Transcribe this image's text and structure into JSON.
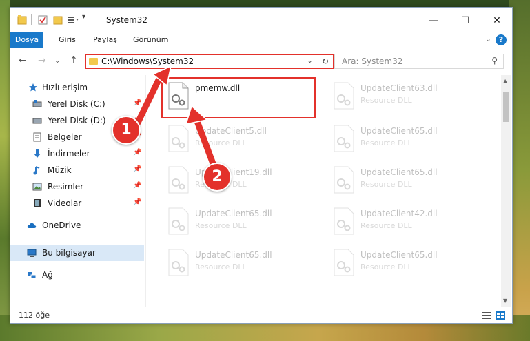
{
  "window": {
    "title": "System32",
    "controls": {
      "minimize": "—",
      "maximize": "☐",
      "close": "✕"
    }
  },
  "ribbon": {
    "tabs": [
      {
        "label": "Dosya",
        "active": true
      },
      {
        "label": "Giriş",
        "active": false
      },
      {
        "label": "Paylaş",
        "active": false
      },
      {
        "label": "Görünüm",
        "active": false
      }
    ],
    "help": "?",
    "collapse": "⌄"
  },
  "nav": {
    "back": "←",
    "forward": "→",
    "recent": "⌄",
    "up": "↑",
    "address": "C:\\Windows\\System32",
    "address_dropdown": "⌄",
    "refresh": "↻",
    "search_placeholder": "Ara: System32",
    "search_icon": "⚲"
  },
  "sidebar": {
    "items": [
      {
        "label": "Hızlı erişim",
        "icon": "star-icon",
        "pinned": false
      },
      {
        "label": "Yerel Disk (C:)",
        "icon": "drive-icon",
        "pinned": true
      },
      {
        "label": "Yerel Disk (D:)",
        "icon": "drive-icon",
        "pinned": true
      },
      {
        "label": "Belgeler",
        "icon": "document-icon",
        "pinned": true
      },
      {
        "label": "İndirmeler",
        "icon": "download-icon",
        "pinned": true
      },
      {
        "label": "Müzik",
        "icon": "music-icon",
        "pinned": true
      },
      {
        "label": "Resimler",
        "icon": "pictures-icon",
        "pinned": true
      },
      {
        "label": "Videolar",
        "icon": "video-icon",
        "pinned": true
      },
      {
        "label": "OneDrive",
        "icon": "cloud-icon",
        "pinned": false
      },
      {
        "label": "Bu bilgisayar",
        "icon": "computer-icon",
        "pinned": false,
        "selected": true
      },
      {
        "label": "Ağ",
        "icon": "network-icon",
        "pinned": false
      }
    ],
    "pin_glyph": "📌"
  },
  "files": [
    {
      "name": "pmemw.dll",
      "type": "",
      "faded": false
    },
    {
      "name": "UpdateClient63.dll",
      "type": "Resource DLL",
      "faded": true
    },
    {
      "name": "UpdateClient5.dll",
      "type": "Resource DLL",
      "faded": true
    },
    {
      "name": "UpdateClient65.dll",
      "type": "Resource DLL",
      "faded": true
    },
    {
      "name": "UpdateClient19.dll",
      "type": "Resource DLL",
      "faded": true
    },
    {
      "name": "UpdateClient65.dll",
      "type": "Resource DLL",
      "faded": true
    },
    {
      "name": "UpdateClient65.dll",
      "type": "Resource DLL",
      "faded": true
    },
    {
      "name": "UpdateClient42.dll",
      "type": "Resource DLL",
      "faded": true
    },
    {
      "name": "UpdateClient65.dll",
      "type": "Resource DLL",
      "faded": true
    },
    {
      "name": "UpdateClient65.dll",
      "type": "Resource DLL",
      "faded": true
    }
  ],
  "status": {
    "count": "112 öğe"
  },
  "callouts": {
    "one": "1",
    "two": "2"
  },
  "colors": {
    "accent": "#1979ca",
    "highlight": "#e3312b",
    "selected": "#d9e8f7"
  }
}
